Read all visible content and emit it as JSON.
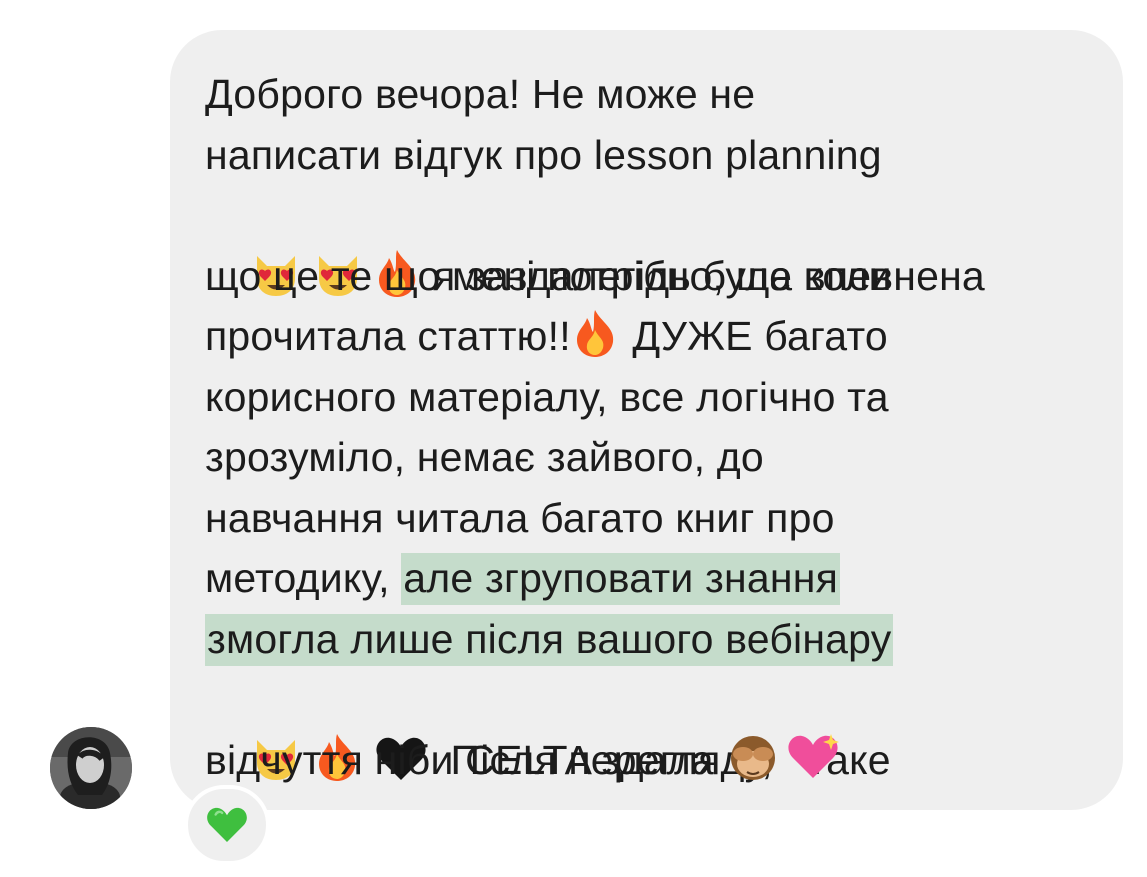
{
  "message": {
    "line_1": "Доброго вечора! Не може не",
    "line_2": "написати відгук про lesson planning",
    "line_3_text": " я заздалегідь була впевнена",
    "line_4": "що це те що мені потрібно, ще коли",
    "line_5_a": "прочитала статтю!!",
    "line_5_b": " ДУЖЕ багато",
    "line_6": "корисного матеріалу, все логічно та",
    "line_7": "зрозуміло, немає зайвого, до",
    "line_8": "навчання читала багато книг про",
    "line_9_a": "методику, ",
    "line_9_highlight": "але згруповати знання",
    "line_10_highlight": "змогла лише після вашого вебінару",
    "line_11_text": "  Після перегляду,   таке",
    "line_12_text": "відчуття ніби CELTA здала "
  },
  "emoji": {
    "line_3": [
      "smiling-cat-heart-eyes",
      "smiling-cat-heart-eyes",
      "fire"
    ],
    "line_5": [
      "fire"
    ],
    "line_11": [
      "smiling-cat-heart-eyes",
      "fire",
      "black-heart"
    ],
    "line_12": [
      "see-no-evil-monkey",
      "sparkling-heart"
    ]
  },
  "reaction": {
    "icon": "green-heart",
    "color": "#3fbf3f"
  },
  "colors": {
    "bubble": "#efefef",
    "highlight": "#c5dccb",
    "text": "#1c1c1c"
  }
}
